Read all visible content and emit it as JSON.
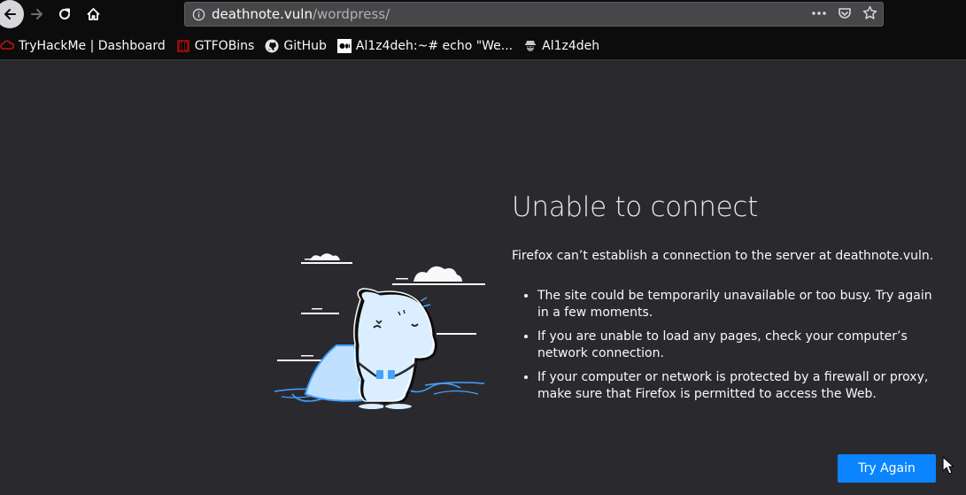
{
  "toolbar": {
    "back_icon": "arrow-left-icon",
    "forward_icon": "arrow-right-icon",
    "reload_icon": "reload-icon",
    "home_icon": "home-icon"
  },
  "urlbar": {
    "host": "deathnote.vuln",
    "path": "/wordpress/",
    "info_icon": "info-icon",
    "menu_icon": "ellipsis-icon",
    "pocket_icon": "pocket-icon",
    "bookmark_icon": "star-icon"
  },
  "bookmarks": [
    {
      "label": "TryHackMe | Dashboard",
      "icon": "tryhackme-icon"
    },
    {
      "label": "GTFOBins",
      "icon": "gtfobins-icon"
    },
    {
      "label": "GitHub",
      "icon": "github-icon"
    },
    {
      "label": "Al1z4deh:~# echo \"We...",
      "icon": "medium-icon"
    },
    {
      "label": "Al1z4deh",
      "icon": "hacker-icon"
    }
  ],
  "error": {
    "title": "Unable to connect",
    "lead": "Firefox can’t establish a connection to the server at deathnote.vuln.",
    "reasons": [
      "The site could be temporarily unavailable or too busy. Try again in a few moments.",
      "If you are unable to load any pages, check your computer’s network connection.",
      "If your computer or network is protected by a firewall or proxy, make sure that Firefox is permitted to access the Web."
    ],
    "button": "Try Again"
  },
  "colors": {
    "background": "#2a2a2e",
    "chrome": "#0c0c0d",
    "accent": "#0a84ff"
  }
}
